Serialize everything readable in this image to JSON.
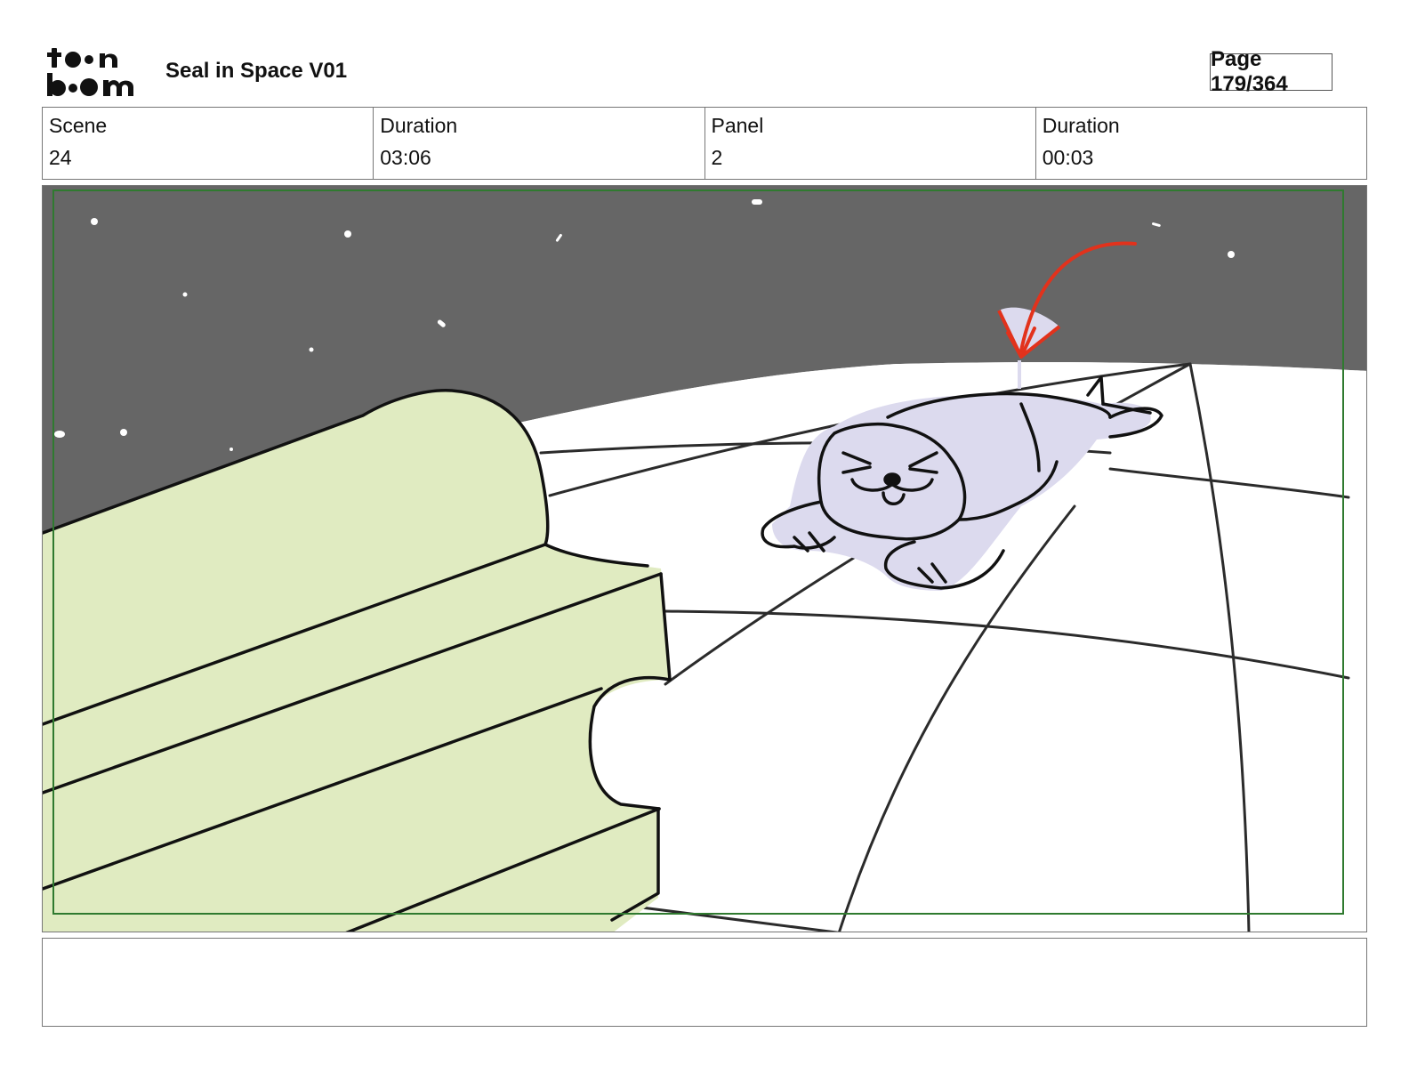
{
  "header": {
    "logo_text": "toon boom",
    "project_title": "Seal in Space V01",
    "page_indicator": "Page 179/364"
  },
  "info": {
    "scene_label": "Scene",
    "scene_value": "24",
    "scene_duration_label": "Duration",
    "scene_duration_value": "03:06",
    "panel_label": "Panel",
    "panel_value": "2",
    "panel_duration_label": "Duration",
    "panel_duration_value": "00:03"
  },
  "panel": {
    "sky_color": "#666666",
    "stair_color": "#e0ebc1",
    "seal_color": "#dcdaee",
    "arrow_color": "#e2321c",
    "safe_frame_color": "#2f7a2f"
  },
  "notes": {
    "text": ""
  }
}
